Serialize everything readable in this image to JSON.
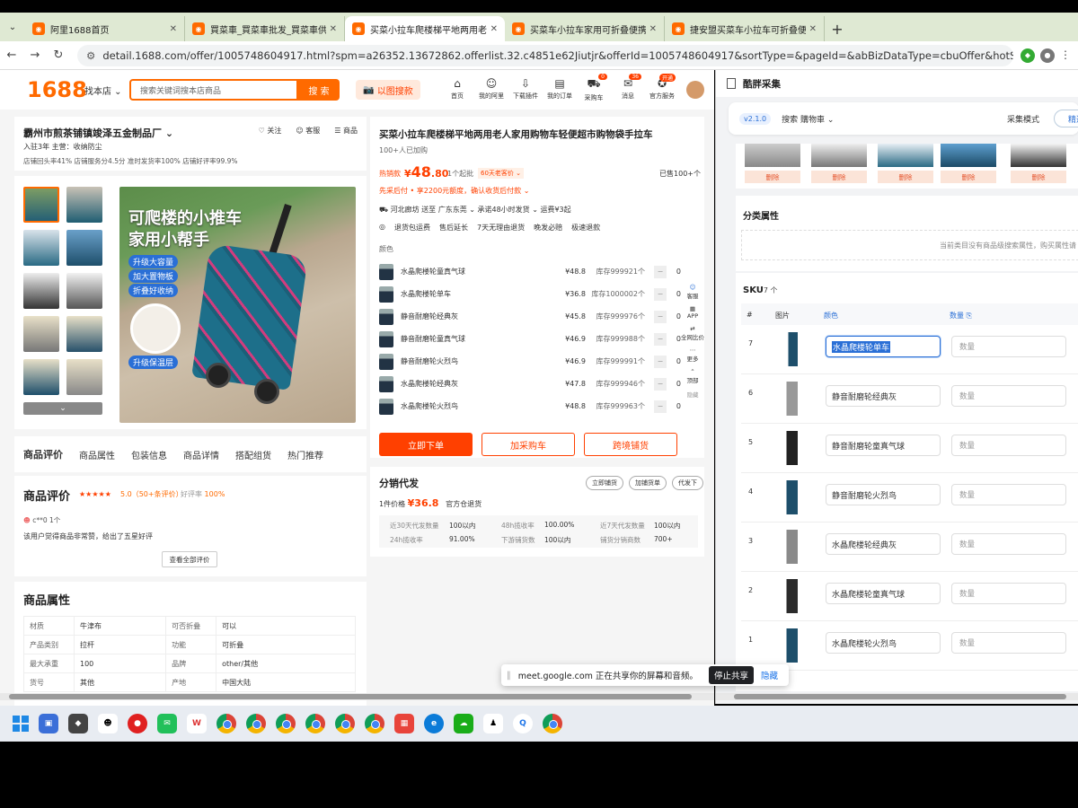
{
  "tabs": [
    {
      "label": "阿里1688首页",
      "active": false
    },
    {
      "label": "買菜車_買菜車批发_買菜車供应",
      "active": false
    },
    {
      "label": "买菜小拉车爬楼梯平地两用老人",
      "active": true
    },
    {
      "label": "买菜车小拉车家用可折叠便携",
      "active": false
    },
    {
      "label": "捷安盟买菜车小拉车可折叠便携",
      "active": false
    }
  ],
  "address": {
    "url": "detail.1688.com/offer/1005748604917.html?spm=a26352.13672862.offerlist.32.c4851e62Jiutjr&offerId=1005748604917&sortType=&pageId=&abBizDataType=cbuOffer&hotSaleSkuId=599814738103..."
  },
  "header": {
    "logo": "1688",
    "find_shop": "找本店 ⌄",
    "search_placeholder": "搜索关键词搜本店商品",
    "search_btn": "搜 索",
    "image_search": "以图搜款",
    "nav": [
      {
        "label": "首页",
        "icon": "home-icon",
        "badge": ""
      },
      {
        "label": "我的阿里",
        "icon": "user-icon",
        "badge": ""
      },
      {
        "label": "下载插件",
        "icon": "download-icon",
        "badge": ""
      },
      {
        "label": "我的订单",
        "icon": "order-icon",
        "badge": ""
      },
      {
        "label": "采购车",
        "icon": "cart-icon",
        "badge": "0"
      },
      {
        "label": "消息",
        "icon": "message-icon",
        "badge": "36"
      },
      {
        "label": "官方服务",
        "icon": "service-icon",
        "badge": "开通"
      }
    ]
  },
  "shop": {
    "name": "霸州市煎茶铺镇竣泽五金制品厂 ⌄",
    "follow": "♡ 关注",
    "service": "☺ 客服",
    "goods": "☰ 商品",
    "meta": "入驻3年    主营：收纳防尘",
    "meta2": "店铺回头率41%    店铺服务分4.5分    准时发货率100%    店铺好评率99.9%"
  },
  "gallery": {
    "headline1": "可爬楼的小推车",
    "headline2": "家用小帮手",
    "tags": [
      "升级大容量",
      "加大置物板",
      "折叠好收纳",
      "升级保温层"
    ]
  },
  "detail_tabs": [
    "商品评价",
    "商品属性",
    "包装信息",
    "商品详情",
    "搭配组货",
    "热门推荐"
  ],
  "reviews": {
    "title": "商品评价",
    "stars": "★★★★★",
    "score": "5.0（50+条评价）",
    "good_rate_label": "好评率",
    "good_rate": "100%",
    "user": "c**0    1个",
    "text": "该用户觉得商品非常赞，给出了五星好评",
    "more": "查看全部评价"
  },
  "attributes": {
    "title": "商品属性",
    "rows": [
      [
        "材质",
        "牛津布",
        "可否折叠",
        "可以"
      ],
      [
        "产品类别",
        "拉杆",
        "功能",
        "可折叠"
      ],
      [
        "最大承重",
        "100",
        "品牌",
        "other/其他"
      ],
      [
        "货号",
        "其他",
        "产地",
        "中国大陆"
      ]
    ]
  },
  "product": {
    "title": "买菜小拉车爬楼梯平地两用老人家用购物车轻便超市购物袋手拉车",
    "sold": "100+人已加购",
    "hot": "热销款",
    "price_yen": "¥",
    "price_int": "48",
    "price_dec": ".80",
    "moq": "1个起批",
    "sixty": "60天老客价 ⌄",
    "sold100": "已售100+个",
    "credit": "先采后付 • 享2200元额度，确认收货后付款 ⌄",
    "ship": "河北廊坊 送至  广东东莞 ⌄    承诺48小时发货 ⌄    运费¥3起",
    "guarantees": [
      "退货包运费",
      "售后延长",
      "7天无理由退货",
      "晚发必赔",
      "极速退款"
    ],
    "color_label": "颜色",
    "skus": [
      {
        "name": "水晶爬楼轮童真气球",
        "price": "¥48.8",
        "stock": "库存999921个",
        "qty": "0"
      },
      {
        "name": "水晶爬楼轮单车",
        "price": "¥36.8",
        "stock": "库存1000002个",
        "qty": "0"
      },
      {
        "name": "静音耐磨轮经典灰",
        "price": "¥45.8",
        "stock": "库存999976个",
        "qty": "0"
      },
      {
        "name": "静音耐磨轮童真气球",
        "price": "¥46.9",
        "stock": "库存999988个",
        "qty": "0"
      },
      {
        "name": "静音耐磨轮火烈鸟",
        "price": "¥46.9",
        "stock": "库存999991个",
        "qty": "0"
      },
      {
        "name": "水晶爬楼轮经典灰",
        "price": "¥47.8",
        "stock": "库存999946个",
        "qty": "0"
      },
      {
        "name": "水晶爬楼轮火烈鸟",
        "price": "¥48.8",
        "stock": "库存999963个",
        "qty": "0"
      }
    ],
    "buy_now": "立即下单",
    "add_cart": "加采购车",
    "cross_border": "跨境铺货"
  },
  "float_bar": [
    "客服",
    "APP",
    "全网比价",
    "更多",
    "顶部",
    "隐藏"
  ],
  "distribution": {
    "title": "分销代发",
    "buttons": [
      "立即铺货",
      "加铺货单",
      "代发下"
    ],
    "price_label": "1件价格",
    "price": "¥36.8",
    "warehouse": "官方仓退货",
    "grid": [
      [
        "近30天代发数量",
        "100以内",
        "48h揽收率",
        "100.00%",
        "近7天代发数量",
        "100以内"
      ],
      [
        "24h揽收率",
        "91.00%",
        "下游铺货数",
        "100以内",
        "铺货分销商数",
        "700+"
      ]
    ]
  },
  "extension": {
    "title": "酷胖采集",
    "version": "v2.1.0",
    "search_select": "搜索 購物車 ⌄",
    "mode_label": "采集模式",
    "mode_value": "精选",
    "delete_label": "删除",
    "category_title": "分类属性",
    "category_empty": "当前类目没有商品级搜索属性，购买属性请",
    "sku_title": "SKU",
    "sku_count": "7 个",
    "columns": [
      "#",
      "图片",
      "颜色",
      "数量 ⎘"
    ],
    "qty_placeholder": "数量",
    "rows": [
      {
        "num": "7",
        "name": "水晶爬楼轮单车",
        "selected": true
      },
      {
        "num": "6",
        "name": "静音耐磨轮经典灰",
        "selected": false
      },
      {
        "num": "5",
        "name": "静音耐磨轮童真气球",
        "selected": false
      },
      {
        "num": "4",
        "name": "静音耐磨轮火烈鸟",
        "selected": false
      },
      {
        "num": "3",
        "name": "水晶爬楼轮经典灰",
        "selected": false
      },
      {
        "num": "2",
        "name": "水晶爬楼轮童真气球",
        "selected": false
      },
      {
        "num": "1",
        "name": "水晶爬楼轮火烈鸟",
        "selected": false
      }
    ]
  },
  "share_banner": {
    "text": "meet.google.com 正在共享你的屏幕和音频。",
    "stop": "停止共享",
    "hide": "隐藏"
  },
  "colors": {
    "brand": "#ff6a00",
    "price": "#ff4000",
    "link": "#2a6fd6"
  }
}
